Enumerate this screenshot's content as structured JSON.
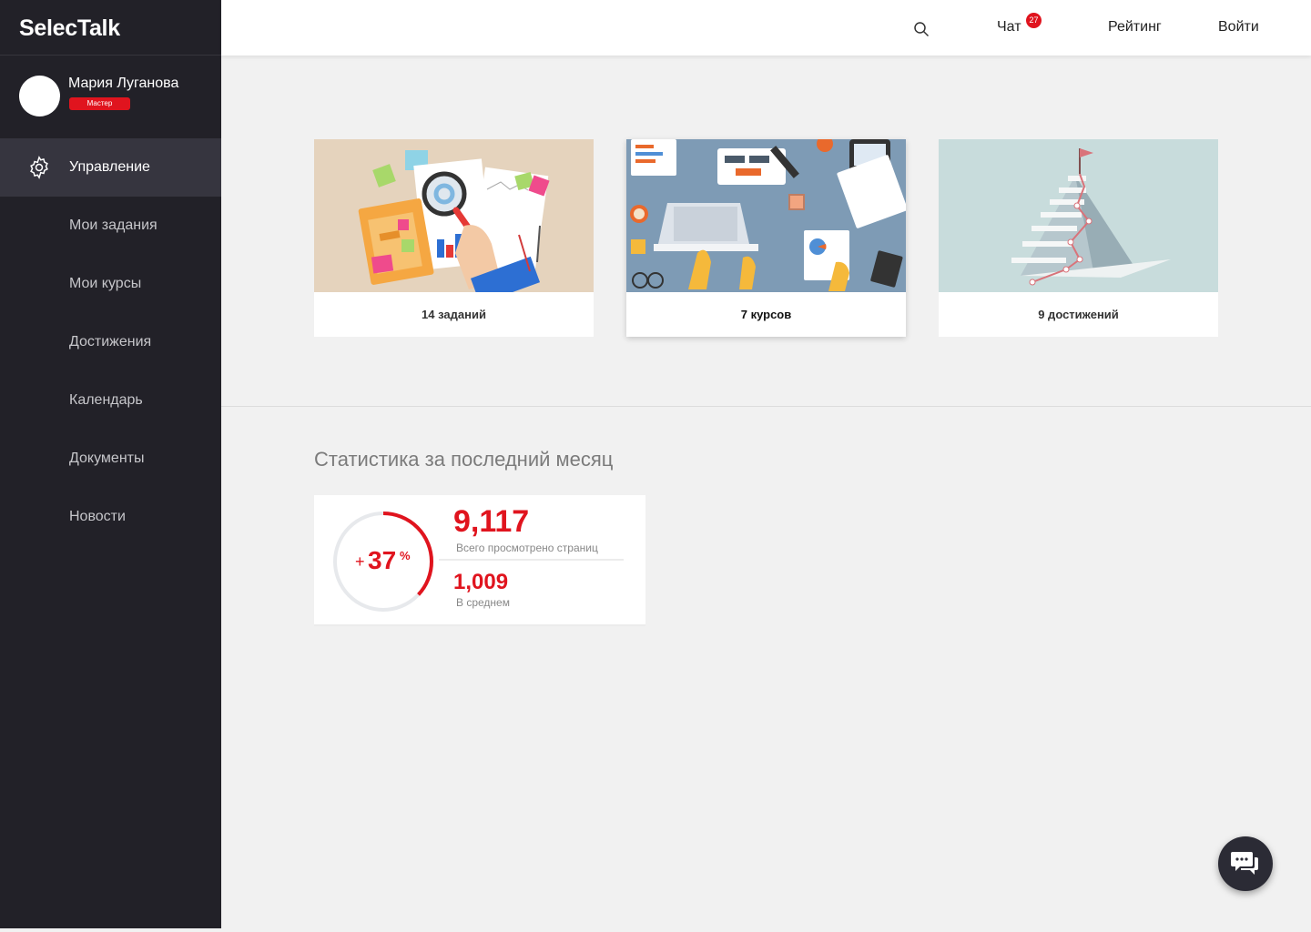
{
  "app": {
    "logo": "SelecTalk"
  },
  "user": {
    "name": "Мария Луганова",
    "role": "Мастер"
  },
  "sidebar": {
    "items": [
      {
        "label": "Управление",
        "icon": "gear-icon",
        "active": true
      },
      {
        "label": "Мои задания"
      },
      {
        "label": "Мои курсы"
      },
      {
        "label": "Достижения"
      },
      {
        "label": "Календарь"
      },
      {
        "label": "Документы"
      },
      {
        "label": "Новости"
      }
    ]
  },
  "header": {
    "search_icon": "search-icon",
    "chat_label": "Чат",
    "chat_badge": "27",
    "rating_label": "Рейтинг",
    "login_label": "Войти"
  },
  "cards": [
    {
      "caption": "14 заданий",
      "illustration": "documents-magnifier"
    },
    {
      "caption": "7 курсов",
      "illustration": "laptop-desk"
    },
    {
      "caption": "9 достижений",
      "illustration": "stairs-mountain-flag"
    }
  ],
  "stats": {
    "title": "Статистика за последний месяц",
    "growth_plus": "+",
    "growth_value": "37",
    "growth_sign": "%",
    "growth_fraction": 0.37,
    "total_value": "9,117",
    "total_label": "Всего просмотрено страниц",
    "avg_value": "1,009",
    "avg_label": "В среднем"
  },
  "colors": {
    "accent": "#e0141e",
    "sidebar_bg": "#222128",
    "sidebar_active": "#36353f",
    "page_bg": "#f1f1f1"
  },
  "chat_fab": {
    "icon": "chat-bubbles-icon"
  }
}
